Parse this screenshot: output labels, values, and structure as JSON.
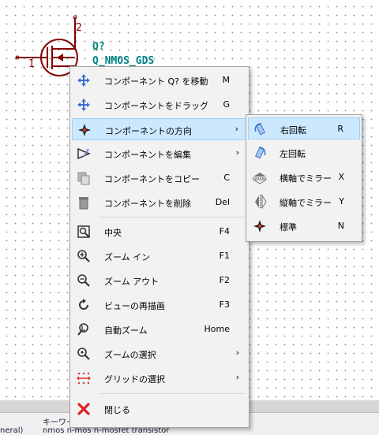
{
  "schematic": {
    "reference": "Q?",
    "value": "Q_NMOS_GDS",
    "pin_number": "1",
    "pin_label_2": "2"
  },
  "context_menu": {
    "items": [
      {
        "label": "コンポーネント Q? を移動",
        "shortcut": "M",
        "icon": "move-icon"
      },
      {
        "label": "コンポーネントをドラッグ",
        "shortcut": "G",
        "icon": "drag-icon"
      },
      {
        "label": "コンポーネントの方向",
        "shortcut": "",
        "icon": "orientation-icon",
        "submenu": true,
        "highlighted": true
      },
      {
        "label": "コンポーネントを編集",
        "shortcut": "",
        "icon": "edit-icon",
        "submenu": true
      },
      {
        "label": "コンポーネントをコピー",
        "shortcut": "C",
        "icon": "copy-icon"
      },
      {
        "label": "コンポーネントを削除",
        "shortcut": "Del",
        "icon": "trash-icon"
      },
      {
        "label": "中央",
        "shortcut": "F4",
        "icon": "center-icon"
      },
      {
        "label": "ズーム イン",
        "shortcut": "F1",
        "icon": "zoom-in-icon"
      },
      {
        "label": "ズーム アウト",
        "shortcut": "F2",
        "icon": "zoom-out-icon"
      },
      {
        "label": "ビューの再描画",
        "shortcut": "F3",
        "icon": "redraw-icon"
      },
      {
        "label": "自動ズーム",
        "shortcut": "Home",
        "icon": "auto-zoom-icon"
      },
      {
        "label": "ズームの選択",
        "shortcut": "",
        "icon": "zoom-select-icon",
        "submenu": true
      },
      {
        "label": "グリッドの選択",
        "shortcut": "",
        "icon": "grid-icon",
        "submenu": true
      },
      {
        "label": "閉じる",
        "shortcut": "",
        "icon": "close-icon"
      }
    ],
    "submenu_arrow": "›"
  },
  "orientation_submenu": {
    "items": [
      {
        "label": "右回転",
        "shortcut": "R",
        "icon": "rotate-cw-icon",
        "highlighted": true
      },
      {
        "label": "左回転",
        "shortcut": "",
        "icon": "rotate-ccw-icon"
      },
      {
        "label": "横軸でミラー",
        "shortcut": "X",
        "icon": "mirror-x-icon"
      },
      {
        "label": "縦軸でミラー",
        "shortcut": "Y",
        "icon": "mirror-y-icon"
      },
      {
        "label": "標準",
        "shortcut": "N",
        "icon": "normal-orientation-icon"
      }
    ]
  },
  "statusbar": {
    "left_text": "neral)",
    "keyword_label": "キーワー",
    "keywords": "nmos n-mos n-mosfet transistor"
  },
  "colors": {
    "menu_bg": "#f2f2f2",
    "highlight": "#cce8ff",
    "symbol": "#840000",
    "field_text": "#008484"
  }
}
